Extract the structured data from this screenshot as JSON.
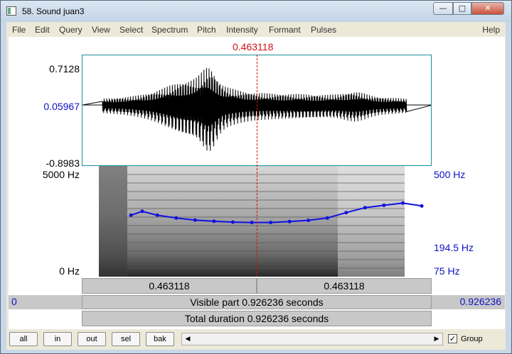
{
  "window": {
    "title": "58. Sound juan3"
  },
  "menu": [
    "File",
    "Edit",
    "Query",
    "View",
    "Select",
    "Spectrum",
    "Pitch",
    "Intensity",
    "Formant",
    "Pulses"
  ],
  "help_label": "Help",
  "cursor": {
    "time_label": "0.463118",
    "time": 0.463118
  },
  "waveform": {
    "max_label": "0.7128",
    "cursor_value_label": "0.05967",
    "min_label": "-0.8983"
  },
  "spectrogram": {
    "top_freq_label": "5000 Hz",
    "bottom_freq_label": "0 Hz"
  },
  "pitch": {
    "top_label": "500 Hz",
    "cursor_label": "194.5 Hz",
    "bottom_label": "75 Hz"
  },
  "time_bar": {
    "left_label": "0.463118",
    "right_label": "0.463118",
    "visible_start": "0",
    "visible_text": "Visible part 0.926236 seconds",
    "visible_end": "0.926236",
    "total_text": "Total duration 0.926236 seconds"
  },
  "nav_buttons": [
    "all",
    "in",
    "out",
    "sel",
    "bak"
  ],
  "group_label": "Group",
  "group_checked": true,
  "chart_data": {
    "type": "line",
    "series": [
      {
        "x": [
          0.13,
          0.16,
          0.2,
          0.25,
          0.3,
          0.35,
          0.4,
          0.45,
          0.5,
          0.55,
          0.6,
          0.65,
          0.7,
          0.75,
          0.8,
          0.85,
          0.9
        ],
        "values": [
          215,
          230,
          215,
          205,
          198,
          194,
          191,
          190,
          190,
          193,
          197,
          205,
          225,
          245,
          255,
          265,
          252
        ]
      }
    ],
    "xlim": [
      0,
      0.926236
    ],
    "ylim": [
      75,
      500
    ],
    "y_scale": "log"
  }
}
